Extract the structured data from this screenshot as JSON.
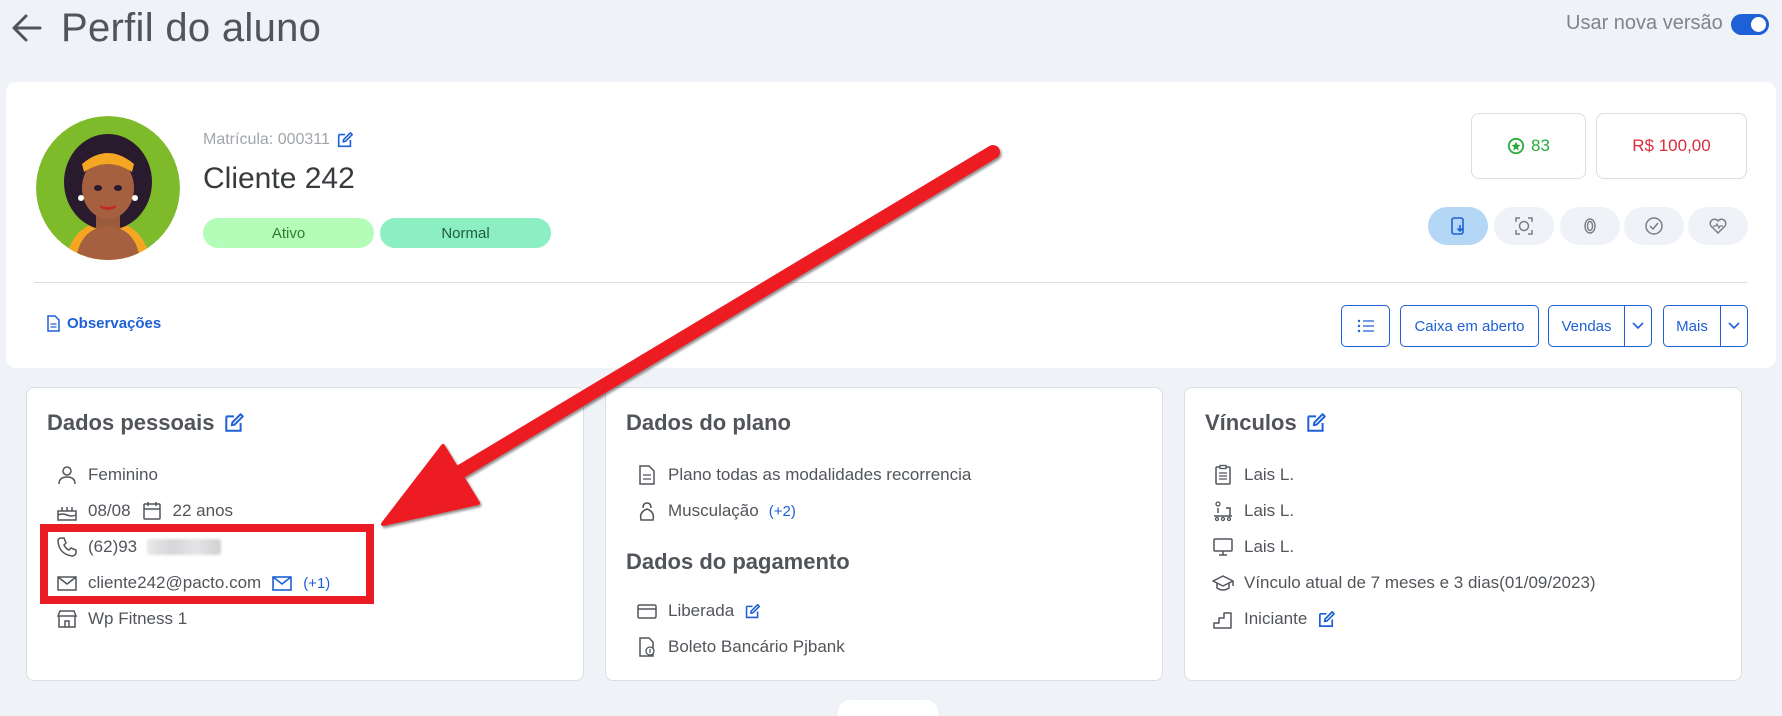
{
  "header": {
    "title": "Perfil do aluno",
    "new_version_label": "Usar nova versão",
    "new_version_enabled": true
  },
  "profile": {
    "matricula": "Matrícula: 000311",
    "name": "Cliente 242",
    "badges": [
      "Ativo",
      "Normal"
    ],
    "points": "83",
    "balance": "R$ 100,00",
    "observations_label": "Observações"
  },
  "actions": {
    "caixa": "Caixa em aberto",
    "vendas": "Vendas",
    "mais": "Mais"
  },
  "personal": {
    "title": "Dados pessoais",
    "gender": "Feminino",
    "birthday": "08/08",
    "age": "22 anos",
    "phone": "(62)93",
    "email": "cliente242@pacto.com",
    "email_extra": "(+1)",
    "unit": "Wp Fitness 1"
  },
  "plan": {
    "title": "Dados do plano",
    "plan_name": "Plano todas as modalidades recorrencia",
    "modality": "Musculação",
    "modality_extra": "(+2)"
  },
  "payment": {
    "title": "Dados do pagamento",
    "status": "Liberada",
    "method": "Boleto Bancário Pjbank"
  },
  "links": {
    "title": "Vínculos",
    "consultant": "Lais L.",
    "trainer": "Lais L.",
    "teacher": "Lais L.",
    "current": "Vínculo atual de 7 meses e 3 dias(01/09/2023)",
    "level": "Iniciante"
  },
  "colors": {
    "primary": "#1e60d5",
    "highlight": "#ec1c24",
    "points": "#28ab3b",
    "money": "#db2c3d"
  }
}
